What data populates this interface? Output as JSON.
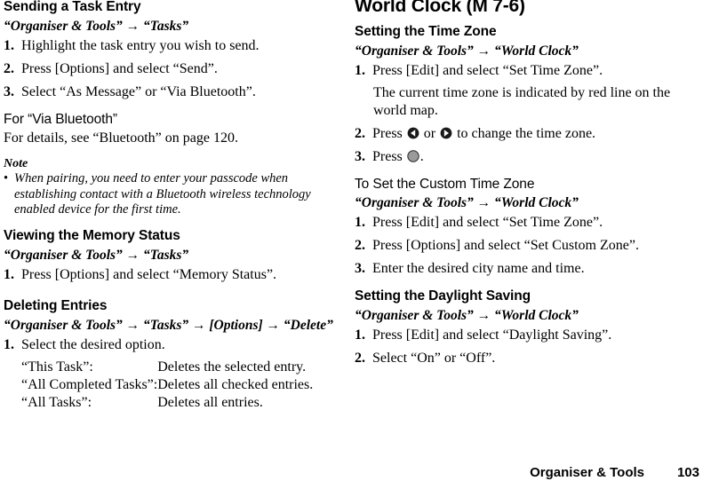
{
  "left_column": {
    "section1": {
      "heading": "Sending a Task Entry",
      "path": "“Organiser & Tools” → “Tasks”",
      "steps": [
        {
          "num": "1.",
          "text": "Highlight the task entry you wish to send."
        },
        {
          "num": "2.",
          "text": "Press [Options] and select “Send”."
        },
        {
          "num": "3.",
          "text": "Select “As Message” or “Via Bluetooth”."
        }
      ],
      "subheading": "For “Via Bluetooth”",
      "sub_body": "For details, see “Bluetooth” on page 120.",
      "note": {
        "heading": "Note",
        "bullet_glyph": "•",
        "items": [
          "When pairing, you need to enter your passcode when establishing contact with a Bluetooth wireless technology enabled device for the first time."
        ]
      }
    },
    "section2": {
      "heading": "Viewing the Memory Status",
      "path": "“Organiser & Tools” → “Tasks”",
      "steps": [
        {
          "num": "1.",
          "text": "Press [Options] and select “Memory Status”."
        }
      ]
    },
    "section3": {
      "heading": "Deleting Entries",
      "path": "“Organiser & Tools” → “Tasks” → [Options] → “Delete”",
      "steps": [
        {
          "num": "1.",
          "text": "Select the desired option."
        }
      ],
      "options_table": [
        {
          "term": "“This Task”:",
          "desc": "Deletes the selected entry."
        },
        {
          "term": "“All Completed Tasks”:",
          "desc": "Deletes all checked entries."
        },
        {
          "term": "“All Tasks”:",
          "desc": "Deletes all entries."
        }
      ]
    }
  },
  "right_column": {
    "title": "World Clock (M 7-6)",
    "section1": {
      "heading": "Setting the Time Zone",
      "path": "“Organiser & Tools” → “World Clock”",
      "step1": {
        "num": "1.",
        "text": "Press [Edit] and select “Set Time Zone”."
      },
      "step1_note": "The current time zone is indicated by red line on the world map.",
      "step2": {
        "num": "2.",
        "text_before": "Press ",
        "text_middle": " or ",
        "text_after": " to change the time zone."
      },
      "step3": {
        "num": "3.",
        "text_before": "Press ",
        "text_after": "."
      }
    },
    "section2": {
      "heading": "To Set the Custom Time Zone",
      "path": "“Organiser & Tools” → “World Clock”",
      "steps": [
        {
          "num": "1.",
          "text": "Press [Edit] and select “Set Time Zone”."
        },
        {
          "num": "2.",
          "text": "Press [Options] and select “Set Custom Zone”."
        },
        {
          "num": "3.",
          "text": "Enter the desired city name and time."
        }
      ]
    },
    "section3": {
      "heading": "Setting the Daylight Saving",
      "path": "“Organiser & Tools” → “World Clock”",
      "steps": [
        {
          "num": "1.",
          "text": "Press [Edit] and select “Daylight Saving”."
        },
        {
          "num": "2.",
          "text": "Select “On” or “Off”."
        }
      ]
    }
  },
  "icons": {
    "left_key": "left-navigation-key-icon",
    "right_key": "right-navigation-key-icon",
    "center_key": "center-select-key-icon"
  },
  "footer": {
    "section_label": "Organiser & Tools",
    "page_number": "103"
  },
  "colors": {
    "text": "#000000",
    "background": "#ffffff",
    "key_dark": "#1a1a1a",
    "key_gray": "#9a9a9a"
  }
}
